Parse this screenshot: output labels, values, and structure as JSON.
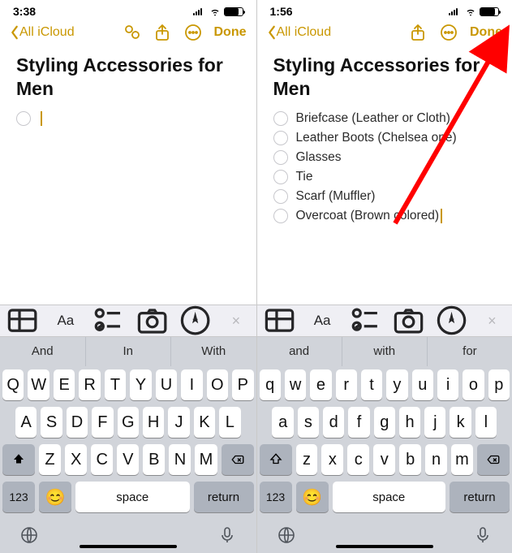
{
  "left": {
    "status": {
      "time": "3:38",
      "alarm": true
    },
    "nav": {
      "back": "All iCloud",
      "done": "Done",
      "icons": [
        "collab",
        "share",
        "more"
      ]
    },
    "note": {
      "title": "Styling Accessories for Men",
      "items": []
    },
    "acc": {
      "buttons": [
        "table",
        "text-format",
        "checklist",
        "camera",
        "markup"
      ],
      "close": "×"
    },
    "sugg": [
      "And",
      "In",
      "With"
    ],
    "rows": [
      [
        "Q",
        "W",
        "E",
        "R",
        "T",
        "Y",
        "U",
        "I",
        "O",
        "P"
      ],
      [
        "A",
        "S",
        "D",
        "F",
        "G",
        "H",
        "J",
        "K",
        "L"
      ],
      [
        "Z",
        "X",
        "C",
        "V",
        "B",
        "N",
        "M"
      ]
    ],
    "numKey": "123",
    "space": "space",
    "ret": "return"
  },
  "right": {
    "status": {
      "time": "1:56",
      "alarm": false
    },
    "nav": {
      "back": "All iCloud",
      "done": "Done",
      "icons": [
        "share",
        "more"
      ]
    },
    "note": {
      "title": "Styling Accessories for Men",
      "items": [
        "Briefcase (Leather or Cloth)",
        "Leather Boots (Chelsea one)",
        "Glasses",
        "Tie",
        "Scarf (Muffler)",
        "Overcoat (Brown colored)"
      ]
    },
    "acc": {
      "buttons": [
        "table",
        "text-format",
        "checklist",
        "camera",
        "markup"
      ],
      "close": "×"
    },
    "sugg": [
      "and",
      "with",
      "for"
    ],
    "rows": [
      [
        "q",
        "w",
        "e",
        "r",
        "t",
        "y",
        "u",
        "i",
        "o",
        "p"
      ],
      [
        "a",
        "s",
        "d",
        "f",
        "g",
        "h",
        "j",
        "k",
        "l"
      ],
      [
        "z",
        "x",
        "c",
        "v",
        "b",
        "n",
        "m"
      ]
    ],
    "numKey": "123",
    "space": "space",
    "ret": "return"
  }
}
